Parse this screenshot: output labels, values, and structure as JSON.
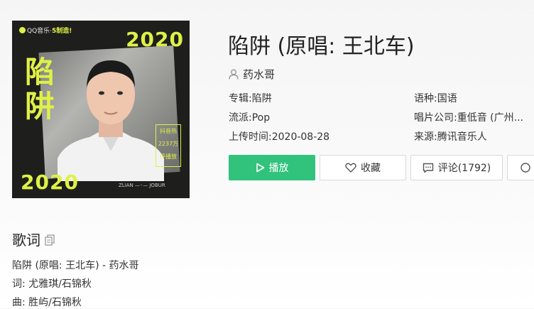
{
  "cover": {
    "logo_text": "QQ音乐",
    "logo_hot": "5制造!",
    "year": "2020",
    "big_chars": [
      "陷",
      "阱"
    ],
    "tag_lines": [
      "抖音热",
      "2237万",
      "评播放"
    ],
    "artist_mark": "ZLIAN —◦— JOBUR"
  },
  "song": {
    "title": "陷阱 (原唱: 王北车)",
    "singer": "药水哥"
  },
  "meta": {
    "album_label": "专辑:",
    "album_value": "陷阱",
    "genre_label": "流派:",
    "genre_value": "Pop",
    "upload_label": "上传时间:",
    "upload_value": "2020-08-28",
    "language_label": "语种:",
    "language_value": "国语",
    "company_label": "唱片公司:",
    "company_value": "重低音 (广州...",
    "source_label": "来源:",
    "source_value": "腾讯音乐人"
  },
  "buttons": {
    "play": "播放",
    "favorite": "收藏",
    "comment": "评论(1792)",
    "more": ""
  },
  "lyrics": {
    "heading": "歌词",
    "lines": [
      "陷阱 (原唱: 王北车) - 药水哥",
      "词: 尤雅琪/石锦秋",
      "曲: 胜屿/石锦秋"
    ]
  },
  "colors": {
    "accent_green": "#31c27c",
    "cover_lime": "#dff146",
    "cover_bg": "#1e1f1c"
  }
}
